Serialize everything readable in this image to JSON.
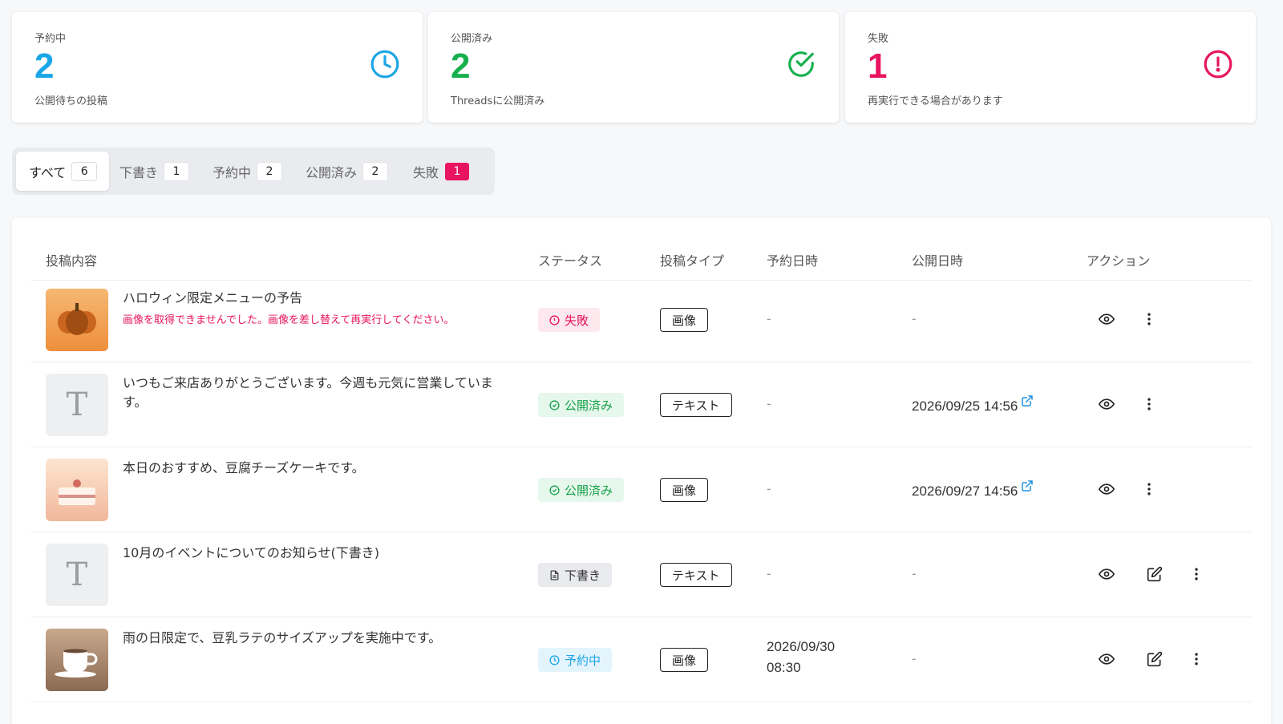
{
  "stats": [
    {
      "label": "予約中",
      "value": "2",
      "desc": "公開待ちの投稿",
      "color": "#1ba6e6",
      "icon": "clock-icon"
    },
    {
      "label": "公開済み",
      "value": "2",
      "desc": "Threadsに公開済み",
      "color": "#18b04f",
      "icon": "check-circle-icon"
    },
    {
      "label": "失敗",
      "value": "1",
      "desc": "再実行できる場合があります",
      "color": "#e8145f",
      "icon": "alert-circle-icon"
    }
  ],
  "tabs": [
    {
      "label": "すべて",
      "count": "6"
    },
    {
      "label": "下書き",
      "count": "1"
    },
    {
      "label": "予約中",
      "count": "2"
    },
    {
      "label": "公開済み",
      "count": "2"
    },
    {
      "label": "失敗",
      "count": "1"
    }
  ],
  "table": {
    "headers": {
      "content": "投稿内容",
      "status": "ステータス",
      "type": "投稿タイプ",
      "scheduled": "予約日時",
      "published": "公開日時",
      "actions": "アクション"
    },
    "rows": [
      {
        "title": "ハロウィン限定メニューの予告",
        "error": "画像を取得できませんでした。画像を差し替えて再実行してください。",
        "status": "失敗",
        "type": "画像",
        "scheduled": "-",
        "published": "-",
        "thumb": "pumpkin-image"
      },
      {
        "title": "いつもご来店ありがとうございます。今週も元気に営業していま す。",
        "status": "公開済み",
        "type": "テキスト",
        "scheduled": "-",
        "published": "2026/09/25 14:56",
        "thumb": "text-placeholder"
      },
      {
        "title": "本日のおすすめ、豆腐チーズケーキです。",
        "status": "公開済み",
        "type": "画像",
        "scheduled": "-",
        "published": "2026/09/27 14:56",
        "thumb": "cake-image"
      },
      {
        "title": "10月のイベントについてのお知らせ(下書き)",
        "status": "下書き",
        "type": "テキスト",
        "scheduled": "-",
        "published": "-",
        "thumb": "text-placeholder"
      },
      {
        "title": "雨の日限定で、豆乳ラテのサイズアップを実施中です。",
        "status": "予約中",
        "type": "画像",
        "scheduled_date": "2026/09/30",
        "scheduled_time": "08:30",
        "published": "-",
        "thumb": "coffee-image"
      }
    ],
    "thumb_text_glyph": "T"
  }
}
